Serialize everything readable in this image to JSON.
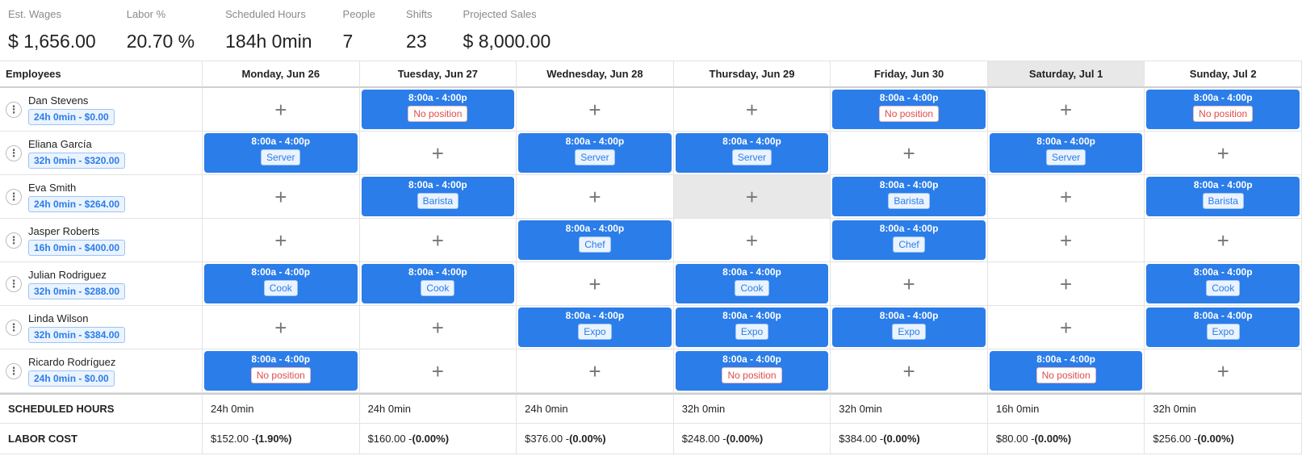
{
  "stats": [
    {
      "label": "Est. Wages",
      "value": "$ 1,656.00"
    },
    {
      "label": "Labor %",
      "value": "20.70 %"
    },
    {
      "label": "Scheduled Hours",
      "value": "184h 0min"
    },
    {
      "label": "People",
      "value": "7"
    },
    {
      "label": "Shifts",
      "value": "23"
    },
    {
      "label": "Projected Sales",
      "value": "$ 8,000.00"
    }
  ],
  "header": {
    "employees_label": "Employees",
    "days": [
      {
        "label": "Monday, Jun 26",
        "weekend": false
      },
      {
        "label": "Tuesday, Jun 27",
        "weekend": false
      },
      {
        "label": "Wednesday, Jun 28",
        "weekend": false
      },
      {
        "label": "Thursday, Jun 29",
        "weekend": false
      },
      {
        "label": "Friday, Jun 30",
        "weekend": false
      },
      {
        "label": "Saturday, Jul 1",
        "weekend": true
      },
      {
        "label": "Sunday, Jul 2",
        "weekend": false
      }
    ]
  },
  "employees": [
    {
      "name": "Dan Stevens",
      "summary": "24h 0min - $0.00",
      "shifts": [
        null,
        {
          "time": "8:00a - 4:00p",
          "position": "No position"
        },
        null,
        null,
        {
          "time": "8:00a - 4:00p",
          "position": "No position"
        },
        null,
        {
          "time": "8:00a - 4:00p",
          "position": "No position"
        }
      ]
    },
    {
      "name": "Eliana García",
      "summary": "32h 0min - $320.00",
      "shifts": [
        {
          "time": "8:00a - 4:00p",
          "position": "Server"
        },
        null,
        {
          "time": "8:00a - 4:00p",
          "position": "Server"
        },
        {
          "time": "8:00a - 4:00p",
          "position": "Server"
        },
        null,
        {
          "time": "8:00a - 4:00p",
          "position": "Server"
        },
        null
      ]
    },
    {
      "name": "Eva Smith",
      "summary": "24h 0min - $264.00",
      "shifts": [
        null,
        {
          "time": "8:00a - 4:00p",
          "position": "Barista"
        },
        null,
        "shaded",
        {
          "time": "8:00a - 4:00p",
          "position": "Barista"
        },
        null,
        {
          "time": "8:00a - 4:00p",
          "position": "Barista"
        }
      ]
    },
    {
      "name": "Jasper Roberts",
      "summary": "16h 0min - $400.00",
      "shifts": [
        null,
        null,
        {
          "time": "8:00a - 4:00p",
          "position": "Chef"
        },
        null,
        {
          "time": "8:00a - 4:00p",
          "position": "Chef"
        },
        null,
        null
      ]
    },
    {
      "name": "Julian Rodriguez",
      "summary": "32h 0min - $288.00",
      "shifts": [
        {
          "time": "8:00a - 4:00p",
          "position": "Cook"
        },
        {
          "time": "8:00a - 4:00p",
          "position": "Cook"
        },
        null,
        {
          "time": "8:00a - 4:00p",
          "position": "Cook"
        },
        null,
        null,
        {
          "time": "8:00a - 4:00p",
          "position": "Cook"
        }
      ]
    },
    {
      "name": "Linda Wilson",
      "summary": "32h 0min - $384.00",
      "shifts": [
        null,
        null,
        {
          "time": "8:00a - 4:00p",
          "position": "Expo"
        },
        {
          "time": "8:00a - 4:00p",
          "position": "Expo"
        },
        {
          "time": "8:00a - 4:00p",
          "position": "Expo"
        },
        null,
        {
          "time": "8:00a - 4:00p",
          "position": "Expo"
        }
      ]
    },
    {
      "name": "Ricardo Rodríguez",
      "summary": "24h 0min - $0.00",
      "shifts": [
        {
          "time": "8:00a - 4:00p",
          "position": "No position"
        },
        null,
        null,
        {
          "time": "8:00a - 4:00p",
          "position": "No position"
        },
        null,
        {
          "time": "8:00a - 4:00p",
          "position": "No position"
        },
        null
      ]
    }
  ],
  "footer": {
    "scheduled_hours_label": "SCHEDULED HOURS",
    "scheduled_hours": [
      "24h 0min",
      "24h 0min",
      "24h 0min",
      "32h 0min",
      "32h 0min",
      "16h 0min",
      "32h 0min"
    ],
    "labor_cost_label": "LABOR COST",
    "labor_cost": [
      {
        "amount": "$152.00 - ",
        "pct": "(1.90%)"
      },
      {
        "amount": "$160.00 - ",
        "pct": "(0.00%)"
      },
      {
        "amount": "$376.00 - ",
        "pct": "(0.00%)"
      },
      {
        "amount": "$248.00 - ",
        "pct": "(0.00%)"
      },
      {
        "amount": "$384.00 - ",
        "pct": "(0.00%)"
      },
      {
        "amount": "$80.00 - ",
        "pct": "(0.00%)"
      },
      {
        "amount": "$256.00 - ",
        "pct": "(0.00%)"
      }
    ]
  },
  "icons": {
    "add": "plus-icon",
    "menu": "kebab-menu-icon"
  },
  "colors": {
    "shift_bg": "#2b7de9",
    "badge_text": "#2b7de9",
    "no_position": "#e24b4b",
    "weekend_bg": "#e8e8e8"
  }
}
